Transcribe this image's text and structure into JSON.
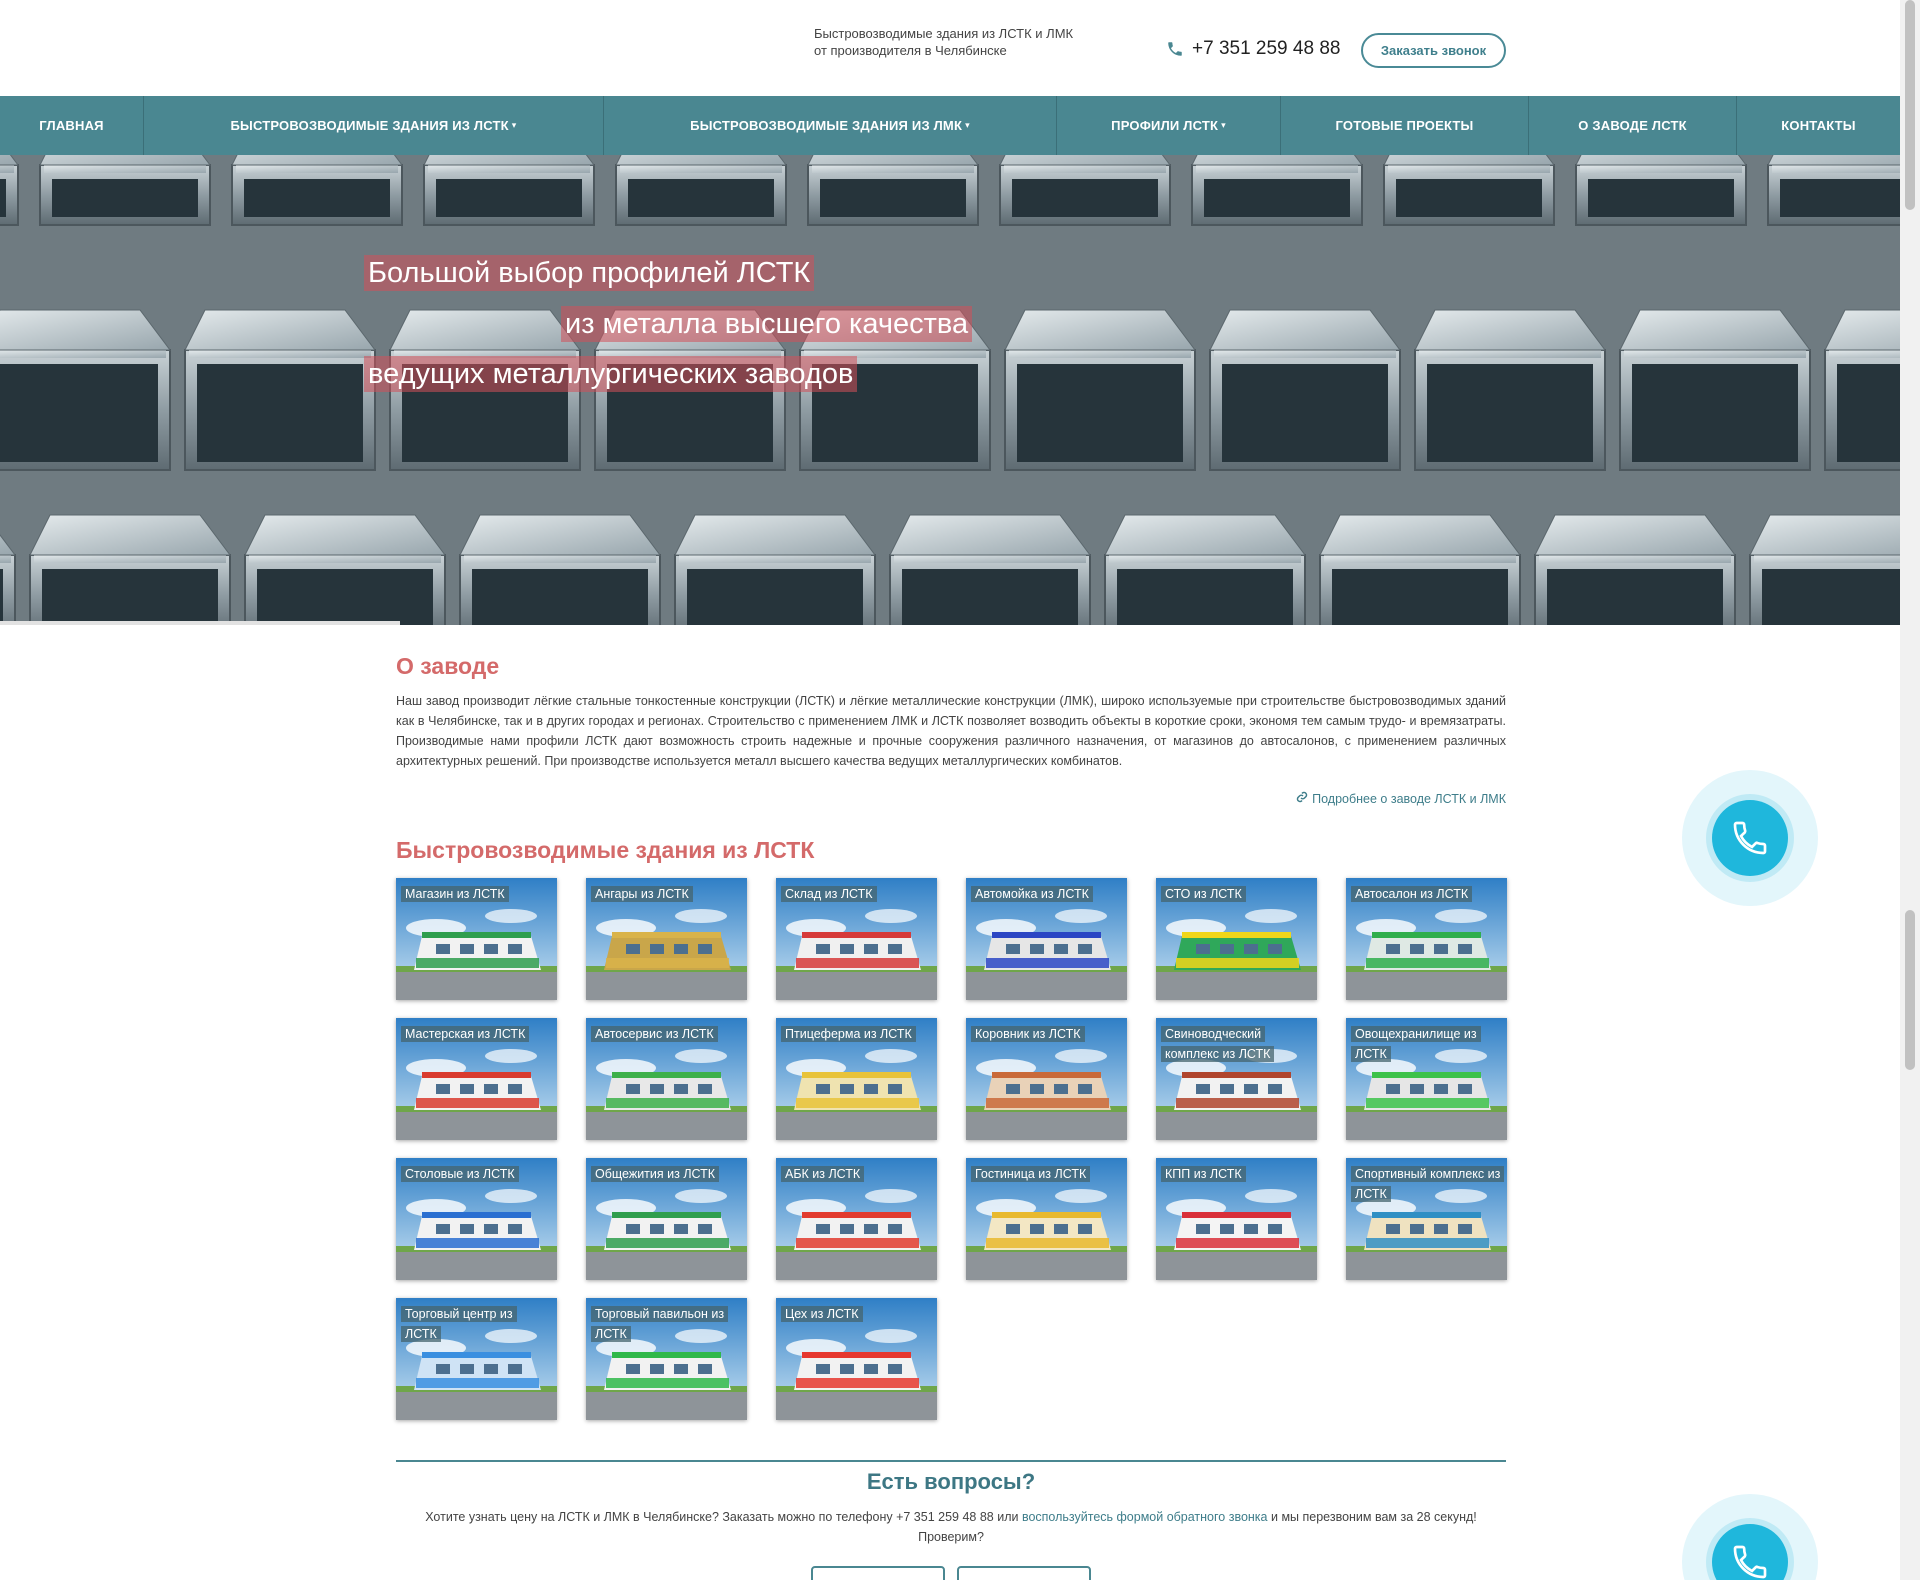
{
  "header": {
    "tagline": "Быстровозводимые здания из ЛСТК и ЛМК от производителя в Челябинске",
    "phone": "+7 351 259 48 88",
    "callback_button": "Заказать звонок",
    "phone_icon": "phone-icon"
  },
  "nav": {
    "items": [
      {
        "label": "ГЛАВНАЯ",
        "dropdown": false
      },
      {
        "label": "БЫСТРОВОЗВОДИМЫЕ ЗДАНИЯ ИЗ ЛСТК",
        "dropdown": true
      },
      {
        "label": "БЫСТРОВОЗВОДИМЫЕ ЗДАНИЯ ИЗ ЛМК",
        "dropdown": true
      },
      {
        "label": "ПРОФИЛИ ЛСТК",
        "dropdown": true
      },
      {
        "label": "ГОТОВЫЕ ПРОЕКТЫ",
        "dropdown": false
      },
      {
        "label": "О ЗАВОДЕ ЛСТК",
        "dropdown": false
      },
      {
        "label": "КОНТАКТЫ",
        "dropdown": false
      }
    ]
  },
  "hero": {
    "lines": [
      "Большой выбор профилей ЛСТК",
      "из металла высшего качества",
      "ведущих металлургических заводов"
    ]
  },
  "about": {
    "title": "О заводе",
    "text": "Наш завод производит лёгкие стальные тонкостенные конструкции (ЛСТК) и лёгкие металлические конструкции (ЛМК), широко используемые при строительстве быстровозводимых зданий как в Челябинске, так и в других городах и регионах. Строительство с применением ЛМК и ЛСТК позволяет возводить объекты в короткие сроки, экономя тем самым трудо- и времязатраты. Производимые нами профили ЛСТК дают возможность строить надежные и прочные сооружения различного назначения, от магазинов до автосалонов, с применением различных архитектурных решений. При производстве используется металл высшего качества ведущих металлургических комбинатов.",
    "link": "Подробнее о заводе ЛСТК и ЛМК",
    "link_icon": "link-icon"
  },
  "buildings": {
    "title": "Быстровозводимые здания из ЛСТК",
    "items": [
      {
        "label": "Магазин из ЛСТК",
        "accent": "#2e9e4e",
        "wall": "#f2f2f2"
      },
      {
        "label": "Ангары из ЛСТК",
        "accent": "#d9b34a",
        "wall": "#c9a64a"
      },
      {
        "label": "Склад из ЛСТК",
        "accent": "#d63a3a",
        "wall": "#f0f0f0"
      },
      {
        "label": "Автомойка из ЛСТК",
        "accent": "#2b46c4",
        "wall": "#e6e6e6"
      },
      {
        "label": "СТО из ЛСТК",
        "accent": "#f0d61a",
        "wall": "#2fa85a"
      },
      {
        "label": "Автосалон из ЛСТК",
        "accent": "#2fae4c",
        "wall": "#dfe9e4"
      },
      {
        "label": "Мастерская из ЛСТК",
        "accent": "#d93b2f",
        "wall": "#f2f2f2"
      },
      {
        "label": "Автосервис из ЛСТК",
        "accent": "#3db04a",
        "wall": "#e8e8e8"
      },
      {
        "label": "Птицеферма из ЛСТК",
        "accent": "#e8c33a",
        "wall": "#efe3b0"
      },
      {
        "label": "Коровник из ЛСТК",
        "accent": "#c96a3a",
        "wall": "#e9d2b8"
      },
      {
        "label": "Свиноводческий комплекс из ЛСТК",
        "accent": "#b0452e",
        "wall": "#f2f2f2"
      },
      {
        "label": "Овощехранилище из ЛСТК",
        "accent": "#3cc24a",
        "wall": "#e6e6e6"
      },
      {
        "label": "Столовые из ЛСТК",
        "accent": "#2a6fd1",
        "wall": "#f2f2f2"
      },
      {
        "label": "Общежития из ЛСТК",
        "accent": "#2f9e4e",
        "wall": "#f2f2f2"
      },
      {
        "label": "АБК из ЛСТК",
        "accent": "#e23b2f",
        "wall": "#f2f2f2"
      },
      {
        "label": "Гостиница из ЛСТК",
        "accent": "#e8b92f",
        "wall": "#f3e7c4"
      },
      {
        "label": "КПП из ЛСТК",
        "accent": "#d92f3a",
        "wall": "#f4f4f4"
      },
      {
        "label": "Спортивный комплекс из ЛСТК",
        "accent": "#2f8fc4",
        "wall": "#efe2c0"
      },
      {
        "label": "Торговый центр из ЛСТК",
        "accent": "#3a8fe0",
        "wall": "#cfe3f5"
      },
      {
        "label": "Торговый павильон из ЛСТК",
        "accent": "#2fb84a",
        "wall": "#f2f2f2"
      },
      {
        "label": "Цех из ЛСТК",
        "accent": "#e6372f",
        "wall": "#f2f2f2"
      }
    ]
  },
  "questions": {
    "title": "Есть вопросы?",
    "text_before": "Хотите узнать цену на ЛСТК и ЛМК в Челябинске? Заказать можно по телефону +7 351 259 48 88 или ",
    "link": "воспользуйтесь формой обратного звонка",
    "text_after": " и мы перезвоним вам за 28 секунд! Проверим?"
  },
  "widgets": {
    "call_icon": "phone-call-icon"
  },
  "colors": {
    "nav_bg": "#4a8791",
    "title_red": "#d46a6a",
    "link_teal": "#3e7d8a",
    "widget_cyan": "#1fb7dc"
  }
}
